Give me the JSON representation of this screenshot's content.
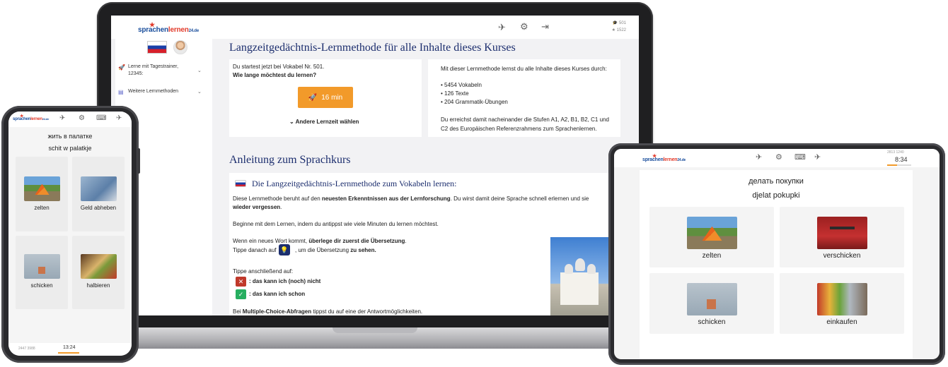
{
  "brand": {
    "logo_main": "sprachen",
    "logo_mid": "lernen",
    "logo_tld": "24.de"
  },
  "laptop": {
    "stats": {
      "words": "501",
      "stars": "1522"
    },
    "sidebar": {
      "items": [
        {
          "icon": "rocket-icon",
          "label": "Lerne mit Tagestrainer, 12345:"
        },
        {
          "icon": "list-icon",
          "label": "Weitere Lernmethoden"
        }
      ]
    },
    "main_title": "Langzeitgedächtnis-Lernmethode für alle Inhalte dieses Kurses",
    "left_card": {
      "line1": "Du startest jetzt bei Vokabel Nr. 501.",
      "line2": "Wie lange möchtest du lernen?",
      "button": "16 min",
      "alt": "Andere Lernzeit wählen"
    },
    "right_card": {
      "intro": "Mit dieser Lernmethode lernst du alle Inhalte dieses Kurses durch:",
      "bullets": [
        "• 5454 Vokabeln",
        "• 126 Texte",
        "• 204 Grammatik-Übungen"
      ],
      "outro1": "Du erreichst damit nacheinander die Stufen A1, A2, B1, B2, C1 und",
      "outro2": "C2 des Europäischen Referenzrahmens zum Sprachenlernen."
    },
    "section_title": "Anleitung zum Sprachkurs",
    "instructions": {
      "heading": "Die Langzeitgedächtnis-Lernmethode zum Vokabeln lernen:",
      "p1a": "Diese Lernmethode beruht auf den",
      "p1b": "neuesten Erkenntnissen aus der Lernforschung",
      "p1c": ". Du wirst damit deine Sprache schnell erlernen und sie",
      "p1d": "wieder vergessen",
      "p1e": ".",
      "p2": "Beginne mit dem Lernen, indem du antippst wie viele Minuten du lernen möchtest.",
      "p3a": "Wenn ein neues Wort kommt,",
      "p3b": "überlege dir zuerst die Übersetzung",
      "p3c": ".",
      "p4a": "Tippe danach auf",
      "p4b": ", um die Übersetzung",
      "p4c": "zu sehen.",
      "p5": "Tippe anschließend auf:",
      "no": ": das kann ich (noch) nicht",
      "yes": ": das kann ich schon",
      "p6a": "Bei",
      "p6b": "Multiple-Choice-Abfragen",
      "p6c": "tippst du auf eine der Antwortmöglichkeiten."
    }
  },
  "phone": {
    "word_ru": "жить в палатке",
    "word_translit": "schit w palatkje",
    "tiles": [
      "zelten",
      "Geld abheben",
      "schicken",
      "halbieren"
    ],
    "stats": "2447  3988",
    "time": "13:24"
  },
  "tablet": {
    "stats": "2813  1240",
    "time": "8:34",
    "word_ru": "делать покупки",
    "word_translit": "djelat pokupki",
    "tiles": [
      "zelten",
      "verschicken",
      "schicken",
      "einkaufen"
    ]
  },
  "colors": {
    "accent_orange": "#f29a2a",
    "title_navy": "#1c2e6e",
    "no_red": "#c0392b",
    "yes_green": "#27ae60"
  }
}
